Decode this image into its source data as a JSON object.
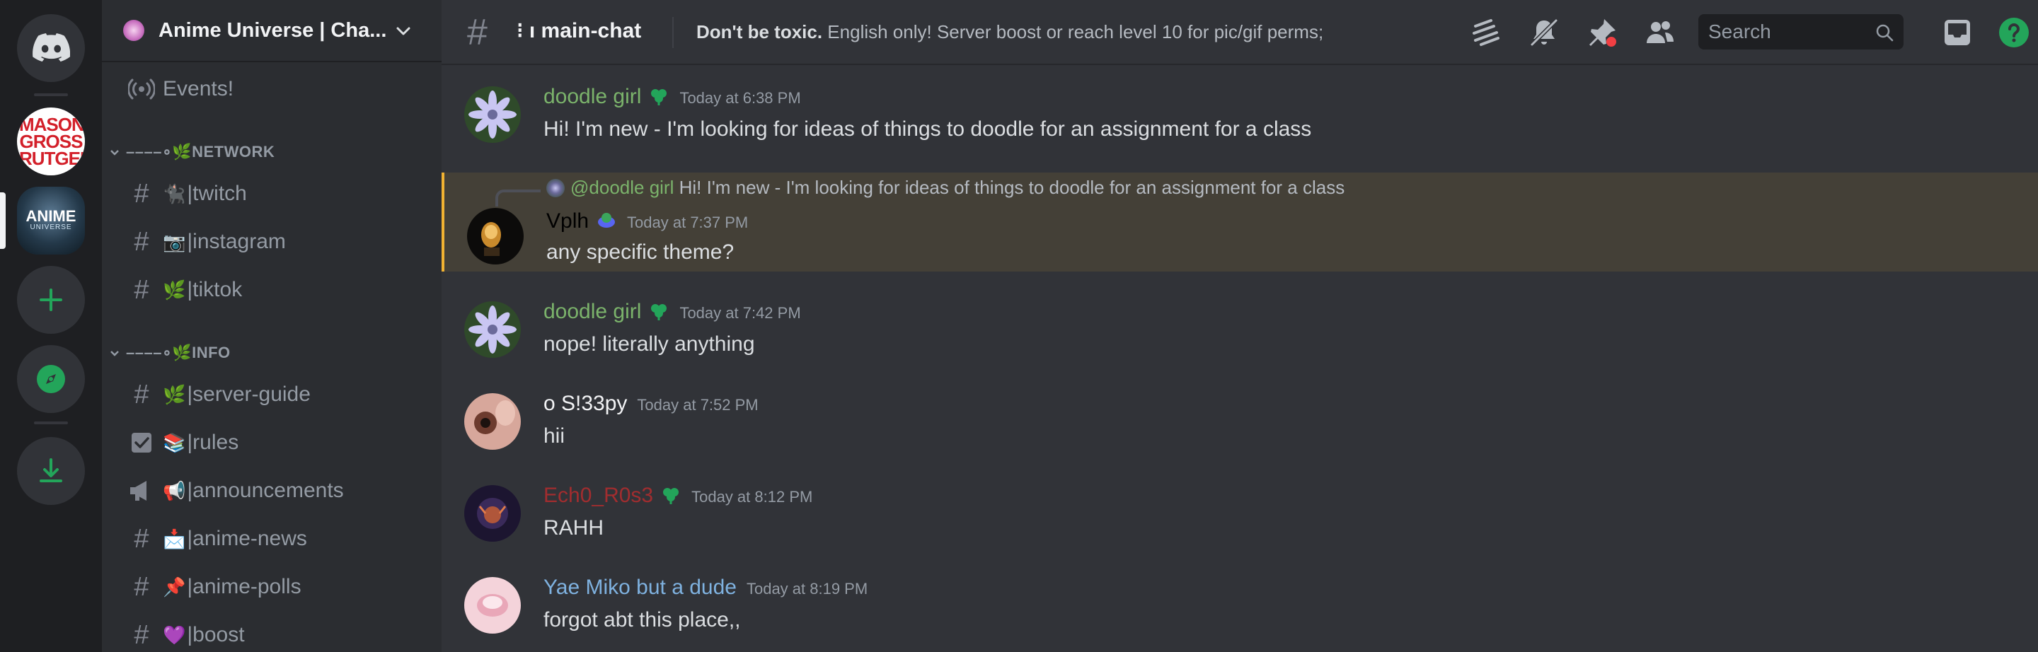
{
  "server_rail": {
    "mason_label": "MASON GROSS RUTGERS",
    "anime_logo_line1": "ANIME",
    "anime_logo_line2": "UNIVERSE"
  },
  "guild": {
    "name": "Anime Universe | Cha..."
  },
  "sidebar": {
    "events_label": "Events!",
    "categories": [
      {
        "label": "NETWORK",
        "prefix": "––––∘🌿"
      },
      {
        "label": "INFO",
        "prefix": "––––∘🌿"
      }
    ],
    "channels": [
      {
        "emoji": "🐈‍⬛",
        "label": "|twitch"
      },
      {
        "emoji": "📷",
        "label": "|instagram"
      },
      {
        "emoji": "🌿",
        "label": "|tiktok"
      },
      {
        "emoji": "🌿",
        "label": "|server-guide"
      },
      {
        "emoji": "📚",
        "label": "|rules"
      },
      {
        "emoji": "📢",
        "label": "|announcements"
      },
      {
        "emoji": "📩",
        "label": "|anime-news"
      },
      {
        "emoji": "📌",
        "label": "|anime-polls"
      },
      {
        "emoji": "💜",
        "label": "|boost"
      }
    ]
  },
  "topbar": {
    "channel_title": "main-chat",
    "topic_bold": "Don't be toxic.",
    "topic_rest": " English only! Server boost or reach level 10 for pic/gif perms;",
    "search_placeholder": "Search"
  },
  "messages": [
    {
      "author": "doodle girl",
      "author_color": "#7bb36b",
      "time": "Today at 6:38 PM",
      "text": "Hi! I'm new - I'm looking for ideas of things to doodle for an assignment for a class"
    },
    {
      "reply_to_author": "@doodle girl",
      "reply_to_text": "Hi! I'm new - I'm looking for ideas of things to doodle for an assignment for a class",
      "author": "Vplh",
      "author_color": "#000000",
      "time": "Today at 7:37 PM",
      "text": "any specific theme?"
    },
    {
      "author": "doodle girl",
      "author_color": "#7bb36b",
      "time": "Today at 7:42 PM",
      "text": "nope! literally anything"
    },
    {
      "author": "o S!33py",
      "author_color": "#f2f3f5",
      "time": "Today at 7:52 PM",
      "text": "hii"
    },
    {
      "author": "Ech0_R0s3",
      "author_color": "#a12d2f",
      "time": "Today at 8:12 PM",
      "text": "RAHH"
    },
    {
      "author": "Yae Miko but a dude",
      "author_color": "#7fb2e0",
      "time": "Today at 8:19 PM",
      "text": "forgot abt this place,,"
    }
  ],
  "colors": {
    "accent_green": "#23a55a",
    "reply_highlight": "#f0b232"
  }
}
